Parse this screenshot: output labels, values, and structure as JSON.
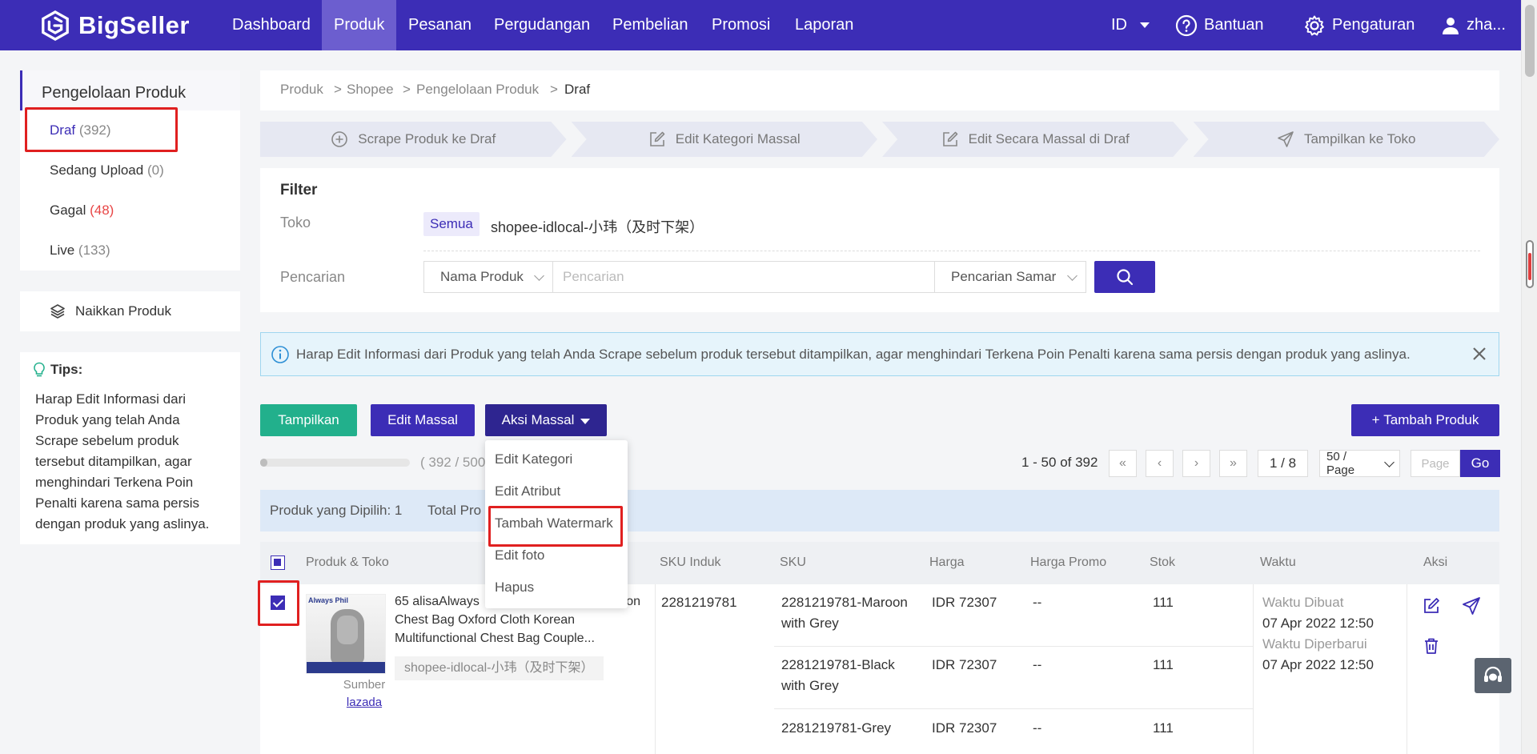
{
  "nav": {
    "logo": "BigSeller",
    "items": [
      "Dashboard",
      "Produk",
      "Pesanan",
      "Pergudangan",
      "Pembelian",
      "Promosi",
      "Laporan"
    ],
    "language": "ID",
    "help": "Bantuan",
    "settings": "Pengaturan",
    "user": "zha..."
  },
  "sidebar": {
    "title": "Pengelolaan Produk",
    "items": [
      {
        "label": "Draf",
        "count": "(392)"
      },
      {
        "label": "Sedang Upload",
        "count": "(0)"
      },
      {
        "label": "Gagal",
        "count": "(48)"
      },
      {
        "label": "Live",
        "count": "(133)"
      }
    ],
    "upload": "Naikkan Produk",
    "tips_title": "Tips:",
    "tips_text": "Harap Edit Informasi dari Produk yang telah Anda Scrape sebelum produk tersebut ditampilkan, agar menghindari Terkena Poin Penalti karena sama persis dengan produk yang aslinya."
  },
  "breadcrumb": {
    "items": [
      "Produk",
      "Shopee",
      "Pengelolaan Produk",
      "Draf"
    ],
    "sep": ">"
  },
  "steps": [
    "Scrape Produk ke Draf",
    "Edit Kategori Massal",
    "Edit Secara Massal di Draf",
    "Tampilkan ke Toko"
  ],
  "filter": {
    "title": "Filter",
    "store_label": "Toko",
    "store_all": "Semua",
    "store_name": "shopee-idlocal-小玮（及时下架）",
    "search_label": "Pencarian",
    "search_field": "Nama Produk",
    "search_placeholder": "Pencarian",
    "search_mode": "Pencarian Samar"
  },
  "alert": "Harap Edit Informasi dari Produk yang telah Anda Scrape sebelum produk tersebut ditampilkan, agar menghindari Terkena Poin Penalti karena sama persis dengan produk yang aslinya.",
  "actions": {
    "publish": "Tampilkan",
    "bulk_edit": "Edit Massal",
    "bulk_action": "Aksi Massal",
    "add_product": "Tambah Produk"
  },
  "bulk_menu": [
    "Edit Kategori",
    "Edit Atribut",
    "Tambah Watermark",
    "Edit foto",
    "Hapus"
  ],
  "progress": {
    "text": "( 392 / 500",
    "fraction": 0.05
  },
  "pagination": {
    "info": "1 - 50 of 392",
    "page": "1 / 8",
    "per_page": "50 / Page",
    "page_placeholder": "Page",
    "go": "Go"
  },
  "selection": {
    "selected": "Produk yang Dipilih: 1",
    "total": "Total Pro"
  },
  "table": {
    "headers": [
      "Produk & Toko",
      "SKU Induk",
      "SKU",
      "Harga",
      "Harga Promo",
      "Stok",
      "Waktu",
      "Aksi"
    ],
    "row": {
      "title": "65 alisaAlways",
      "title_end": "on",
      "title_line2": "Chest Bag Oxford Cloth Korean",
      "title_line3": "Multifunctional Chest Bag Couple...",
      "thumb_brand": "Always Phil",
      "shop": "shopee-idlocal-小玮（及时下架）",
      "source_label": "Sumber",
      "source_link": "lazada",
      "parent_sku": "2281219781",
      "variants": [
        {
          "sku_line1": "2281219781-Maroon",
          "sku_line2": "with Grey",
          "price": "IDR 72307",
          "promo": "--",
          "stock": "111"
        },
        {
          "sku_line1": "2281219781-Black",
          "sku_line2": "with Grey",
          "price": "IDR 72307",
          "promo": "--",
          "stock": "111"
        },
        {
          "sku_line1": "2281219781-Grey",
          "sku_line2": "",
          "price": "IDR 72307",
          "promo": "--",
          "stock": "111"
        }
      ],
      "created_label": "Waktu Dibuat",
      "created": "07 Apr 2022 12:50",
      "updated_label": "Waktu Diperbarui",
      "updated": "07 Apr 2022 12:50"
    }
  },
  "colors": {
    "brand": "#3c2db6",
    "green": "#22b08c",
    "alert_bg": "#e6f4fb",
    "highlight": "#e02020"
  }
}
